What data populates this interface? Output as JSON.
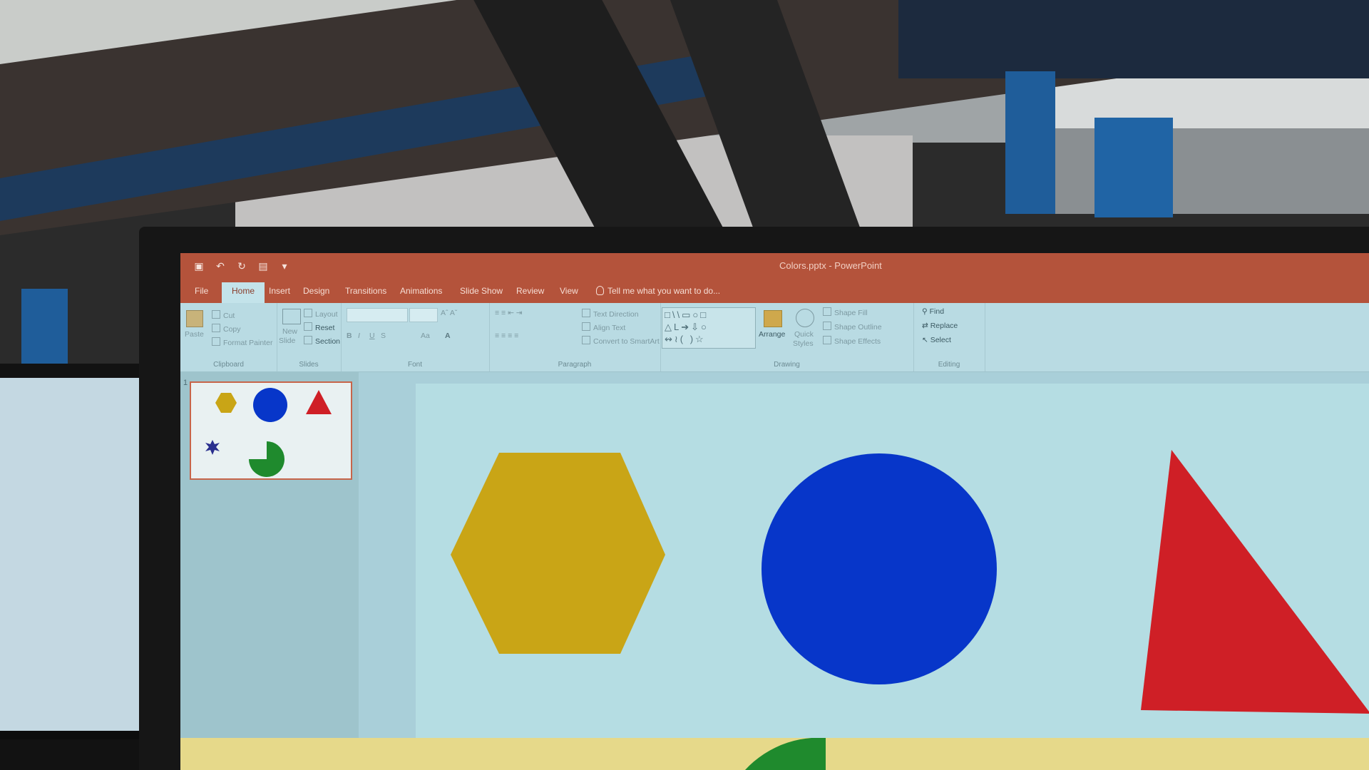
{
  "app": {
    "window_title": "Colors.pptx - PowerPoint",
    "tabs": [
      "File",
      "Home",
      "Insert",
      "Design",
      "Transitions",
      "Animations",
      "Slide Show",
      "Review",
      "View"
    ],
    "active_tab": "Home",
    "tell_me": "Tell me what you want to do..."
  },
  "ribbon": {
    "clipboard": {
      "paste": "Paste",
      "cut": "Cut",
      "copy": "Copy",
      "format_painter": "Format Painter",
      "label": "Clipboard"
    },
    "slides": {
      "new_slide": "New",
      "new_slide_2": "Slide",
      "layout": "Layout",
      "reset": "Reset",
      "section": "Section",
      "label": "Slides"
    },
    "font": {
      "label": "Font",
      "bold": "B",
      "italic": "I",
      "underline": "U",
      "strike": "S",
      "aa": "Aa",
      "font_color": "A"
    },
    "paragraph": {
      "text_direction": "Text Direction",
      "align_text": "Align Text",
      "convert_smartart": "Convert to SmartArt",
      "label": "Paragraph"
    },
    "drawing": {
      "arrange": "Arrange",
      "quick_styles": "Quick",
      "quick_styles_2": "Styles",
      "shape_fill": "Shape Fill",
      "shape_outline": "Shape Outline",
      "shape_effects": "Shape Effects",
      "label": "Drawing"
    },
    "editing": {
      "find": "Find",
      "replace": "Replace",
      "select": "Select",
      "label": "Editing"
    }
  },
  "thumbnails": {
    "slide_number": "1"
  },
  "colors": {
    "hexagon": "#c9a516",
    "circle": "#0736c9",
    "triangle": "#cf1f26",
    "pie": "#1f8a2d",
    "star": "#2a2f8e",
    "titlebar": "#b4533b"
  },
  "icons": [
    "save-icon",
    "undo-icon",
    "redo-icon",
    "present-icon",
    "lightbulb-icon",
    "find-icon",
    "replace-icon",
    "select-icon"
  ]
}
